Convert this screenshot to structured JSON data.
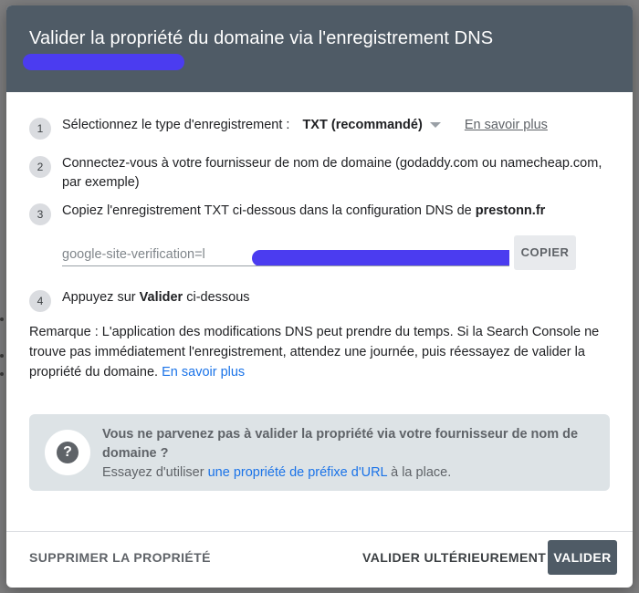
{
  "dialog": {
    "title": "Valider la propriété du domaine via l'enregistrement DNS"
  },
  "steps": [
    {
      "number": "1",
      "label": "Sélectionnez le type d'enregistrement :",
      "select_value": "TXT (recommandé)",
      "link": "En savoir plus"
    },
    {
      "number": "2",
      "text": "Connectez-vous à votre fournisseur de nom de domaine (godaddy.com ou namecheap.com, par exemple)"
    },
    {
      "number": "3",
      "text_before": "Copiez l'enregistrement TXT ci-dessous dans la configuration DNS de ",
      "domain": "prestonn.fr"
    },
    {
      "number": "4",
      "text_before": "Appuyez sur ",
      "bold": "Valider",
      "text_after": " ci-dessous"
    }
  ],
  "txt_record": {
    "value": "google-site-verification=l",
    "copy_label": "COPIER"
  },
  "note": {
    "text": "Remarque : L'application des modifications DNS peut prendre du temps. Si la Search Console ne trouve pas immédiatement l'enregistrement, attendez une journée, puis réessayez de valider la propriété du domaine.",
    "link": "En savoir plus"
  },
  "info_box": {
    "title": "Vous ne parvenez pas à valider la propriété via votre fournisseur de nom de domaine ?",
    "text_before": "Essayez d'utiliser ",
    "link": "une propriété de préfixe d'URL",
    "text_after": " à la place.",
    "icon": "help-icon",
    "icon_glyph": "?"
  },
  "footer": {
    "delete_label": "SUPPRIMER LA PROPRIÉTÉ",
    "later_label": "VALIDER ULTÉRIEUREMENT",
    "validate_label": "VALIDER"
  },
  "colors": {
    "header": "#4f5b66",
    "redaction": "#4b3cf0",
    "link": "#1a73e8",
    "info_box": "#dde3e6"
  }
}
